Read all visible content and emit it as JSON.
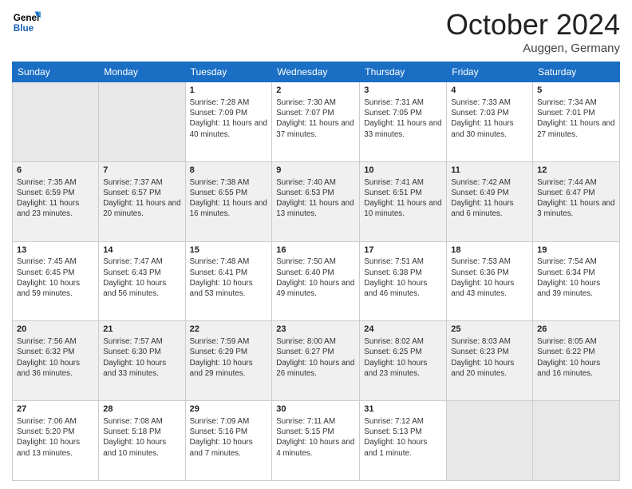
{
  "header": {
    "logo_line1": "General",
    "logo_line2": "Blue",
    "month": "October 2024",
    "location": "Auggen, Germany"
  },
  "days_of_week": [
    "Sunday",
    "Monday",
    "Tuesday",
    "Wednesday",
    "Thursday",
    "Friday",
    "Saturday"
  ],
  "weeks": [
    [
      {
        "day": "",
        "info": "",
        "empty": true
      },
      {
        "day": "",
        "info": "",
        "empty": true
      },
      {
        "day": "1",
        "info": "Sunrise: 7:28 AM\nSunset: 7:09 PM\nDaylight: 11 hours and 40 minutes."
      },
      {
        "day": "2",
        "info": "Sunrise: 7:30 AM\nSunset: 7:07 PM\nDaylight: 11 hours and 37 minutes."
      },
      {
        "day": "3",
        "info": "Sunrise: 7:31 AM\nSunset: 7:05 PM\nDaylight: 11 hours and 33 minutes."
      },
      {
        "day": "4",
        "info": "Sunrise: 7:33 AM\nSunset: 7:03 PM\nDaylight: 11 hours and 30 minutes."
      },
      {
        "day": "5",
        "info": "Sunrise: 7:34 AM\nSunset: 7:01 PM\nDaylight: 11 hours and 27 minutes."
      }
    ],
    [
      {
        "day": "6",
        "info": "Sunrise: 7:35 AM\nSunset: 6:59 PM\nDaylight: 11 hours and 23 minutes."
      },
      {
        "day": "7",
        "info": "Sunrise: 7:37 AM\nSunset: 6:57 PM\nDaylight: 11 hours and 20 minutes."
      },
      {
        "day": "8",
        "info": "Sunrise: 7:38 AM\nSunset: 6:55 PM\nDaylight: 11 hours and 16 minutes."
      },
      {
        "day": "9",
        "info": "Sunrise: 7:40 AM\nSunset: 6:53 PM\nDaylight: 11 hours and 13 minutes."
      },
      {
        "day": "10",
        "info": "Sunrise: 7:41 AM\nSunset: 6:51 PM\nDaylight: 11 hours and 10 minutes."
      },
      {
        "day": "11",
        "info": "Sunrise: 7:42 AM\nSunset: 6:49 PM\nDaylight: 11 hours and 6 minutes."
      },
      {
        "day": "12",
        "info": "Sunrise: 7:44 AM\nSunset: 6:47 PM\nDaylight: 11 hours and 3 minutes."
      }
    ],
    [
      {
        "day": "13",
        "info": "Sunrise: 7:45 AM\nSunset: 6:45 PM\nDaylight: 10 hours and 59 minutes."
      },
      {
        "day": "14",
        "info": "Sunrise: 7:47 AM\nSunset: 6:43 PM\nDaylight: 10 hours and 56 minutes."
      },
      {
        "day": "15",
        "info": "Sunrise: 7:48 AM\nSunset: 6:41 PM\nDaylight: 10 hours and 53 minutes."
      },
      {
        "day": "16",
        "info": "Sunrise: 7:50 AM\nSunset: 6:40 PM\nDaylight: 10 hours and 49 minutes."
      },
      {
        "day": "17",
        "info": "Sunrise: 7:51 AM\nSunset: 6:38 PM\nDaylight: 10 hours and 46 minutes."
      },
      {
        "day": "18",
        "info": "Sunrise: 7:53 AM\nSunset: 6:36 PM\nDaylight: 10 hours and 43 minutes."
      },
      {
        "day": "19",
        "info": "Sunrise: 7:54 AM\nSunset: 6:34 PM\nDaylight: 10 hours and 39 minutes."
      }
    ],
    [
      {
        "day": "20",
        "info": "Sunrise: 7:56 AM\nSunset: 6:32 PM\nDaylight: 10 hours and 36 minutes."
      },
      {
        "day": "21",
        "info": "Sunrise: 7:57 AM\nSunset: 6:30 PM\nDaylight: 10 hours and 33 minutes."
      },
      {
        "day": "22",
        "info": "Sunrise: 7:59 AM\nSunset: 6:29 PM\nDaylight: 10 hours and 29 minutes."
      },
      {
        "day": "23",
        "info": "Sunrise: 8:00 AM\nSunset: 6:27 PM\nDaylight: 10 hours and 26 minutes."
      },
      {
        "day": "24",
        "info": "Sunrise: 8:02 AM\nSunset: 6:25 PM\nDaylight: 10 hours and 23 minutes."
      },
      {
        "day": "25",
        "info": "Sunrise: 8:03 AM\nSunset: 6:23 PM\nDaylight: 10 hours and 20 minutes."
      },
      {
        "day": "26",
        "info": "Sunrise: 8:05 AM\nSunset: 6:22 PM\nDaylight: 10 hours and 16 minutes."
      }
    ],
    [
      {
        "day": "27",
        "info": "Sunrise: 7:06 AM\nSunset: 5:20 PM\nDaylight: 10 hours and 13 minutes."
      },
      {
        "day": "28",
        "info": "Sunrise: 7:08 AM\nSunset: 5:18 PM\nDaylight: 10 hours and 10 minutes."
      },
      {
        "day": "29",
        "info": "Sunrise: 7:09 AM\nSunset: 5:16 PM\nDaylight: 10 hours and 7 minutes."
      },
      {
        "day": "30",
        "info": "Sunrise: 7:11 AM\nSunset: 5:15 PM\nDaylight: 10 hours and 4 minutes."
      },
      {
        "day": "31",
        "info": "Sunrise: 7:12 AM\nSunset: 5:13 PM\nDaylight: 10 hours and 1 minute."
      },
      {
        "day": "",
        "info": "",
        "empty": true
      },
      {
        "day": "",
        "info": "",
        "empty": true
      }
    ]
  ]
}
